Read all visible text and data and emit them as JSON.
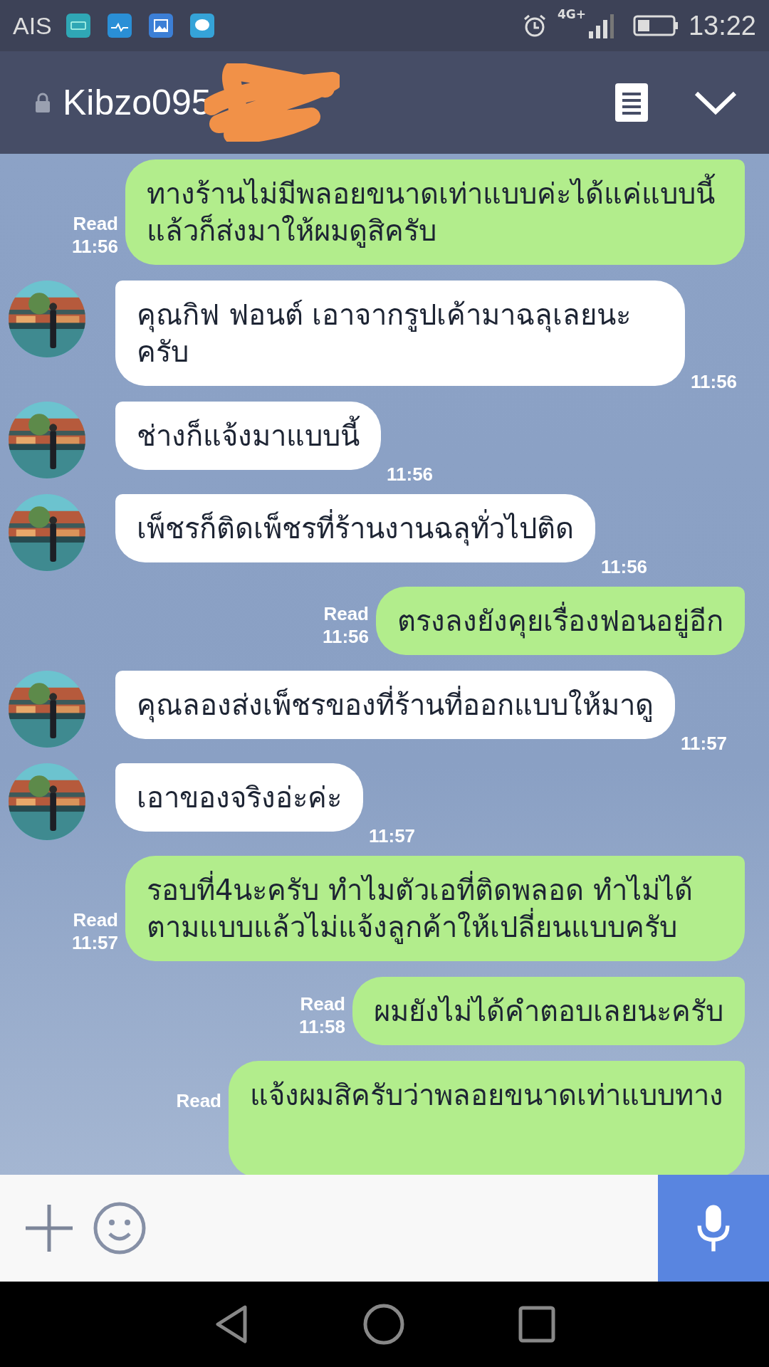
{
  "status_bar": {
    "carrier": "AIS",
    "network": "4G+",
    "time": "13:22"
  },
  "header": {
    "title": "Kibzo095"
  },
  "messages": [
    {
      "kind": "sent",
      "text": "ทางร้านไม่มีพลอยขนาดเท่าแบบค่ะได้แค่แบบนี้แล้วก็ส่งมาให้ผมดูสิครับ",
      "read": "Read",
      "time": "11:56"
    },
    {
      "kind": "received",
      "text": "คุณกิฟ ฟอนต์ เอาจากรูปเค้ามาฉลุเลยนะครับ",
      "time": "11:56"
    },
    {
      "kind": "received",
      "text": "ช่างก็แจ้งมาแบบนี้",
      "time": "11:56"
    },
    {
      "kind": "received",
      "text": "เพ็ชรก็ติดเพ็ชรที่ร้านงานฉลุทั่วไปติด",
      "time": "11:56"
    },
    {
      "kind": "sent",
      "text": "ตรงลงยังคุยเรื่องฟอนอยู่อีก",
      "read": "Read",
      "time": "11:56"
    },
    {
      "kind": "received",
      "text": "คุณลองส่งเพ็ชรของที่ร้านที่ออกแบบให้มาดู",
      "time": "11:57"
    },
    {
      "kind": "received",
      "text": "เอาของจริงอ่ะค่ะ",
      "time": "11:57"
    },
    {
      "kind": "sent",
      "text": "รอบที่4นะครับ ทำไมตัวเอที่ติดพลอด ทำไม่ได้ตามแบบแล้วไม่แจ้งลูกค้าให้เปลี่ยนแบบครับ",
      "read": "Read",
      "time": "11:57"
    },
    {
      "kind": "sent",
      "text": "ผมยังไม่ได้คำตอบเลยนะครับ",
      "read": "Read",
      "time": "11:58"
    },
    {
      "kind": "sent",
      "text": "แจ้งผมสิครับว่าพลอยขนาดเท่าแบบทาง",
      "read": "Read",
      "cut": true
    }
  ]
}
